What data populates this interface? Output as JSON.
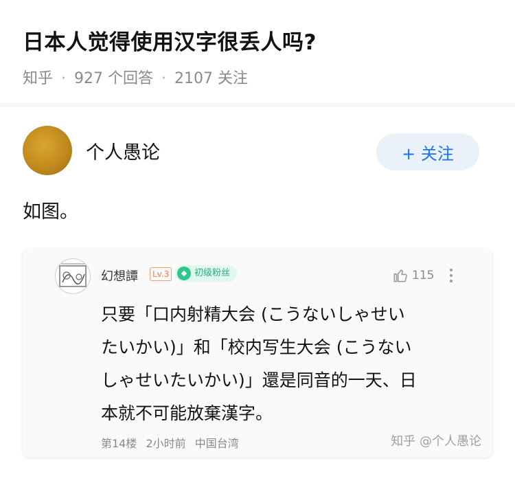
{
  "question": {
    "title": "日本人觉得使用汉字很丢人吗?",
    "source": "知乎",
    "answers_count": "927",
    "answers_label": "个回答",
    "followers_count": "2107",
    "followers_label": "关注"
  },
  "answer": {
    "author": "个人愚论",
    "follow_label": "+ 关注",
    "text": "如图。"
  },
  "comment": {
    "author": "幻想譚",
    "level": "Lv.3",
    "fan_badge": "初级粉丝",
    "likes": "115",
    "body_lines": [
      "只要「口内射精大会 (こうないしゃせい",
      "たいかい)」和「校内写生大会 (こうない",
      "しゃせいたいかい)」還是同音的一天、日",
      "本就不可能放棄漢字。"
    ],
    "floor": "第14楼",
    "time": "2小时前",
    "location": "中国台湾",
    "watermark": "知乎 @个人愚论"
  },
  "icons": {
    "like": "thumbs-up-icon",
    "more": "more-vertical-icon",
    "gem": "diamond-icon"
  },
  "colors": {
    "brand_blue": "#1772f6",
    "follow_bg": "#eaf1f8",
    "level_orange": "#ff7a45",
    "fan_green": "#21b07a"
  }
}
